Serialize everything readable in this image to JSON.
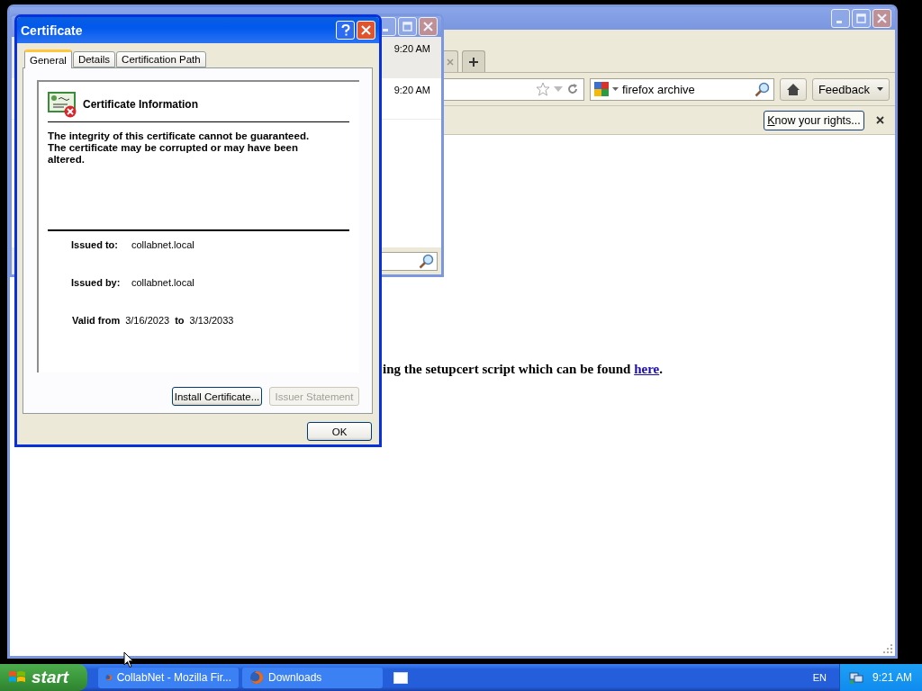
{
  "browser": {
    "search": {
      "value": "firefox archive"
    },
    "feedback_button": "Feedback",
    "notification": {
      "button": "Know your rights..."
    },
    "content": {
      "text": "ing the setupcert script which can be found ",
      "link": "here",
      "after": "."
    }
  },
  "downloads": {
    "rows": [
      {
        "time": "9:20 AM",
        "selected": true
      },
      {
        "time": "9:20 AM",
        "selected": false
      }
    ]
  },
  "dialog": {
    "title": "Certificate",
    "tabs": [
      {
        "label": "General",
        "selected": true
      },
      {
        "label": "Details",
        "selected": false
      },
      {
        "label": "Certification Path",
        "selected": false
      }
    ],
    "heading": "Certificate Information",
    "message": "The integrity of this certificate cannot be guaranteed. The certificate may be corrupted or may have been altered.",
    "fields": [
      {
        "label": "Issued to:",
        "value": "collabnet.local"
      },
      {
        "label": "Issued by:",
        "value": "collabnet.local"
      }
    ],
    "valid": {
      "label": "Valid from",
      "from": "3/16/2023",
      "to_label": "to",
      "to": "3/13/2033"
    },
    "buttons": [
      {
        "label": "Install Certificate...",
        "disabled": false
      },
      {
        "label": "Issuer Statement",
        "disabled": true
      }
    ],
    "ok": "OK"
  },
  "taskbar": {
    "start": "start",
    "tasks": [
      {
        "label": "CollabNet - Mozilla Fir...",
        "selected": false
      },
      {
        "label": "Downloads",
        "selected": false
      }
    ],
    "language": "EN",
    "clock": "9:21 AM"
  }
}
